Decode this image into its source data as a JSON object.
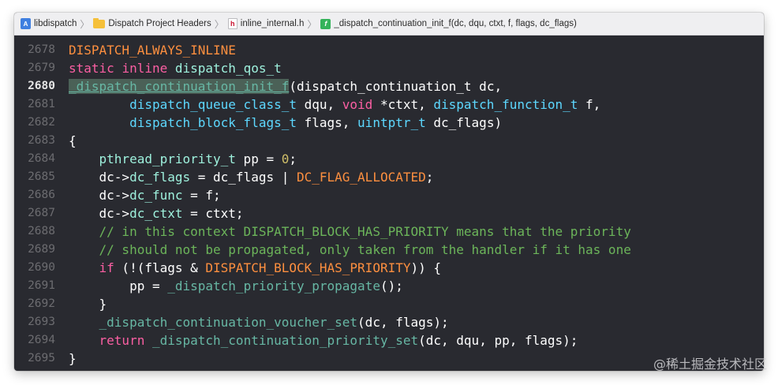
{
  "breadcrumbs": [
    {
      "label": "libdispatch",
      "icon": "project-icon"
    },
    {
      "label": "Dispatch Project Headers",
      "icon": "folder-icon"
    },
    {
      "label": "inline_internal.h",
      "icon": "header-file-icon"
    },
    {
      "label": "_dispatch_continuation_init_f(dc, dqu, ctxt, f, flags, dc_flags)",
      "icon": "function-icon"
    }
  ],
  "icon_glyphs": {
    "project": "A",
    "header": "h",
    "function": "f"
  },
  "current_line": "2680",
  "colors": {
    "editor_background": "#292a30",
    "keyword": "#fc5fa3",
    "type": "#5dd8ff",
    "macro": "#fd8f3f",
    "function": "#67b7a4",
    "number": "#d0bf69",
    "comment": "#6cb55a"
  },
  "code": {
    "lines": [
      {
        "num": "2678",
        "segs": [
          {
            "text": "DISPATCH_ALWAYS_INLINE",
            "cls": "m"
          }
        ]
      },
      {
        "num": "2679",
        "segs": [
          {
            "text": "static",
            "cls": "k"
          },
          {
            "text": " "
          },
          {
            "text": "inline",
            "cls": "k"
          },
          {
            "text": " "
          },
          {
            "text": "dispatch_qos_t",
            "cls": "t2"
          }
        ]
      },
      {
        "num": "2680",
        "segs": [
          {
            "text": "_dispatch_continuation_init_f",
            "cls": "hl"
          },
          {
            "text": "(dispatch_continuation_t dc,"
          }
        ]
      },
      {
        "num": "2681",
        "segs": [
          {
            "text": "        "
          },
          {
            "text": "dispatch_queue_class_t",
            "cls": "t"
          },
          {
            "text": " dqu, "
          },
          {
            "text": "void",
            "cls": "k"
          },
          {
            "text": " *ctxt, "
          },
          {
            "text": "dispatch_function_t",
            "cls": "t"
          },
          {
            "text": " f,"
          }
        ]
      },
      {
        "num": "2682",
        "segs": [
          {
            "text": "        "
          },
          {
            "text": "dispatch_block_flags_t",
            "cls": "t"
          },
          {
            "text": " flags, "
          },
          {
            "text": "uintptr_t",
            "cls": "t"
          },
          {
            "text": " dc_flags)"
          }
        ]
      },
      {
        "num": "2683",
        "segs": [
          {
            "text": "{"
          }
        ]
      },
      {
        "num": "2684",
        "segs": [
          {
            "text": "    "
          },
          {
            "text": "pthread_priority_t",
            "cls": "t2"
          },
          {
            "text": " pp = "
          },
          {
            "text": "0",
            "cls": "n"
          },
          {
            "text": ";"
          }
        ]
      },
      {
        "num": "2685",
        "segs": [
          {
            "text": "    dc->"
          },
          {
            "text": "dc_flags",
            "cls": "t2"
          },
          {
            "text": " = dc_flags | "
          },
          {
            "text": "DC_FLAG_ALLOCATED",
            "cls": "m"
          },
          {
            "text": ";"
          }
        ]
      },
      {
        "num": "2686",
        "segs": [
          {
            "text": "    dc->"
          },
          {
            "text": "dc_func",
            "cls": "t2"
          },
          {
            "text": " = f;"
          }
        ]
      },
      {
        "num": "2687",
        "segs": [
          {
            "text": "    dc->"
          },
          {
            "text": "dc_ctxt",
            "cls": "t2"
          },
          {
            "text": " = ctxt;"
          }
        ]
      },
      {
        "num": "2688",
        "segs": [
          {
            "text": "    // in this context DISPATCH_BLOCK_HAS_PRIORITY means that the priority",
            "cls": "c"
          }
        ]
      },
      {
        "num": "2689",
        "segs": [
          {
            "text": "    // should not be propagated, only taken from the handler if it has one",
            "cls": "c"
          }
        ]
      },
      {
        "num": "2690",
        "segs": [
          {
            "text": "    "
          },
          {
            "text": "if",
            "cls": "k"
          },
          {
            "text": " (!(flags & "
          },
          {
            "text": "DISPATCH_BLOCK_HAS_PRIORITY",
            "cls": "m"
          },
          {
            "text": ")) {"
          }
        ]
      },
      {
        "num": "2691",
        "segs": [
          {
            "text": "        pp = "
          },
          {
            "text": "_dispatch_priority_propagate",
            "cls": "f"
          },
          {
            "text": "();"
          }
        ]
      },
      {
        "num": "2692",
        "segs": [
          {
            "text": "    }"
          }
        ]
      },
      {
        "num": "2693",
        "segs": [
          {
            "text": "    "
          },
          {
            "text": "_dispatch_continuation_voucher_set",
            "cls": "f"
          },
          {
            "text": "(dc, flags);"
          }
        ]
      },
      {
        "num": "2694",
        "segs": [
          {
            "text": "    "
          },
          {
            "text": "return",
            "cls": "k"
          },
          {
            "text": " "
          },
          {
            "text": "_dispatch_continuation_priority_set",
            "cls": "f"
          },
          {
            "text": "(dc, dqu, pp, flags);"
          }
        ]
      },
      {
        "num": "2695",
        "segs": [
          {
            "text": "}"
          }
        ]
      }
    ]
  },
  "watermark": "@稀土掘金技术社区"
}
